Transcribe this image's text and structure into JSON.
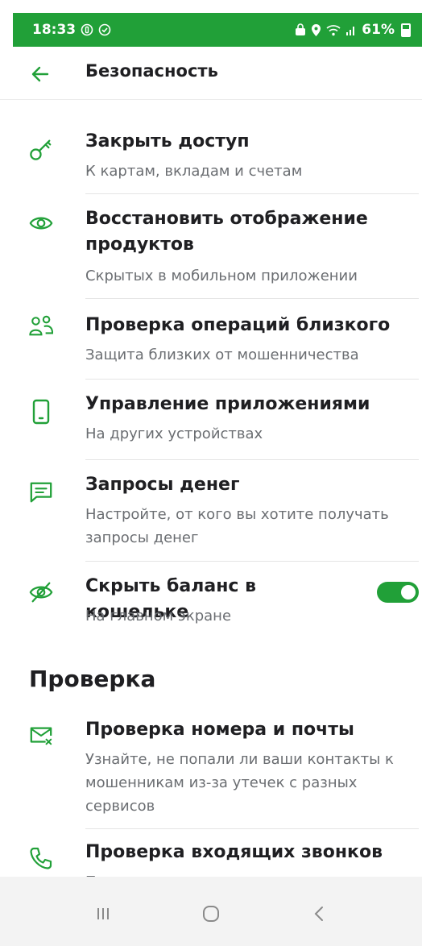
{
  "status_bar": {
    "time": "18:33",
    "battery": "61%",
    "left_icons": [
      "vpn-icon",
      "shield-check-icon"
    ],
    "right_icons": [
      "lock-icon",
      "location-icon",
      "wifi-icon",
      "signal-icon",
      "battery-icon"
    ]
  },
  "header": {
    "back_icon": "arrow-left-icon",
    "title": "Безопасность"
  },
  "accent_color": "#21a038",
  "items": [
    {
      "icon": "key-icon",
      "title": "Закрыть доступ",
      "subtitle": "К картам, вкладам и счетам"
    },
    {
      "icon": "eye-icon",
      "title": "Восстановить отображение продуктов",
      "subtitle": "Скрытых в мобильном приложении"
    },
    {
      "icon": "users-icon",
      "title": "Проверка операций близкого",
      "subtitle": "Защита близких от мошенничества"
    },
    {
      "icon": "phone-icon",
      "title": "Управление приложениями",
      "subtitle": "На других устройствах"
    },
    {
      "icon": "message-icon",
      "title": "Запросы денег",
      "subtitle": "Настройте, от кого вы хотите получать запросы денег"
    },
    {
      "icon": "eye-off-icon",
      "title": "Скрыть баланс в кошельке",
      "subtitle": "На главном экране",
      "toggle_on": true
    }
  ],
  "section": {
    "title": "Проверка",
    "items": [
      {
        "icon": "mail-check-icon",
        "title": "Проверка номера и почты",
        "subtitle": "Узнайте, не попали ли ваши контакты к мошенникам из-за утечек с разных сервисов"
      },
      {
        "icon": "phone-call-icon",
        "title": "Проверка входящих звонков",
        "subtitle": "Предупредим о звонках мошенников,"
      }
    ]
  },
  "nav_bar": {
    "buttons": [
      "recent-apps-icon",
      "home-icon",
      "back-icon"
    ]
  }
}
